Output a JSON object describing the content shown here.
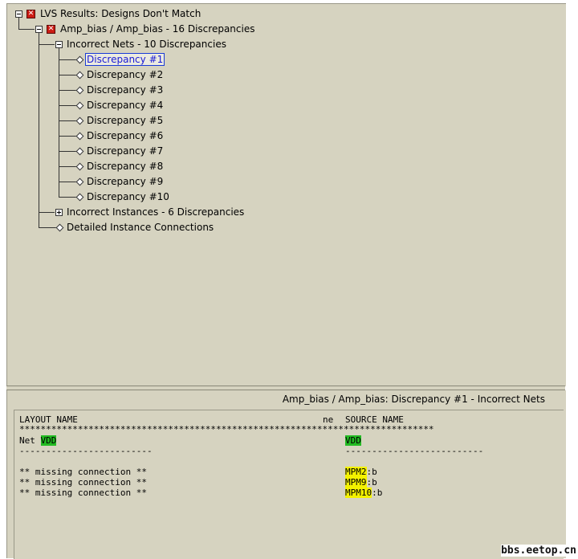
{
  "tree": {
    "root": {
      "label": "LVS Results: Designs Don't Match"
    },
    "cell": {
      "label": "Amp_bias / Amp_bias - 16 Discrepancies"
    },
    "incorrect_nets": {
      "label": "Incorrect Nets - 10 Discrepancies",
      "items": [
        "Discrepancy #1",
        "Discrepancy #2",
        "Discrepancy #3",
        "Discrepancy #4",
        "Discrepancy #5",
        "Discrepancy #6",
        "Discrepancy #7",
        "Discrepancy #8",
        "Discrepancy #9",
        "Discrepancy #10"
      ],
      "selected_index": 0
    },
    "incorrect_instances": {
      "label": "Incorrect Instances - 6 Discrepancies"
    },
    "detailed_connections": {
      "label": "Detailed Instance Connections"
    }
  },
  "detail": {
    "title": "Amp_bias / Amp_bias: Discrepancy #1 - Incorrect Nets",
    "layout_header": "LAYOUT NAME",
    "ne_header": "ne",
    "source_header": "SOURCE NAME",
    "star_rule": "******************************************************************************",
    "net_prefix": "Net ",
    "layout_net": "VDD",
    "source_net": "VDD",
    "layout_dash": "-------------------------",
    "source_dash": "--------------------------",
    "rows": [
      {
        "layout": "** missing connection **",
        "source_inst": "MPM2",
        "source_pin": ":b"
      },
      {
        "layout": "** missing connection **",
        "source_inst": "MPM9",
        "source_pin": ":b"
      },
      {
        "layout": "** missing connection **",
        "source_inst": "MPM10",
        "source_pin": ":b"
      }
    ]
  },
  "watermark": "bbs.eetop.cn",
  "colors": {
    "pane_bg": "#d6d3c0",
    "highlight_net": "#22bb22",
    "highlight_inst": "#f4f200",
    "error_icon": "#cc1c14"
  }
}
